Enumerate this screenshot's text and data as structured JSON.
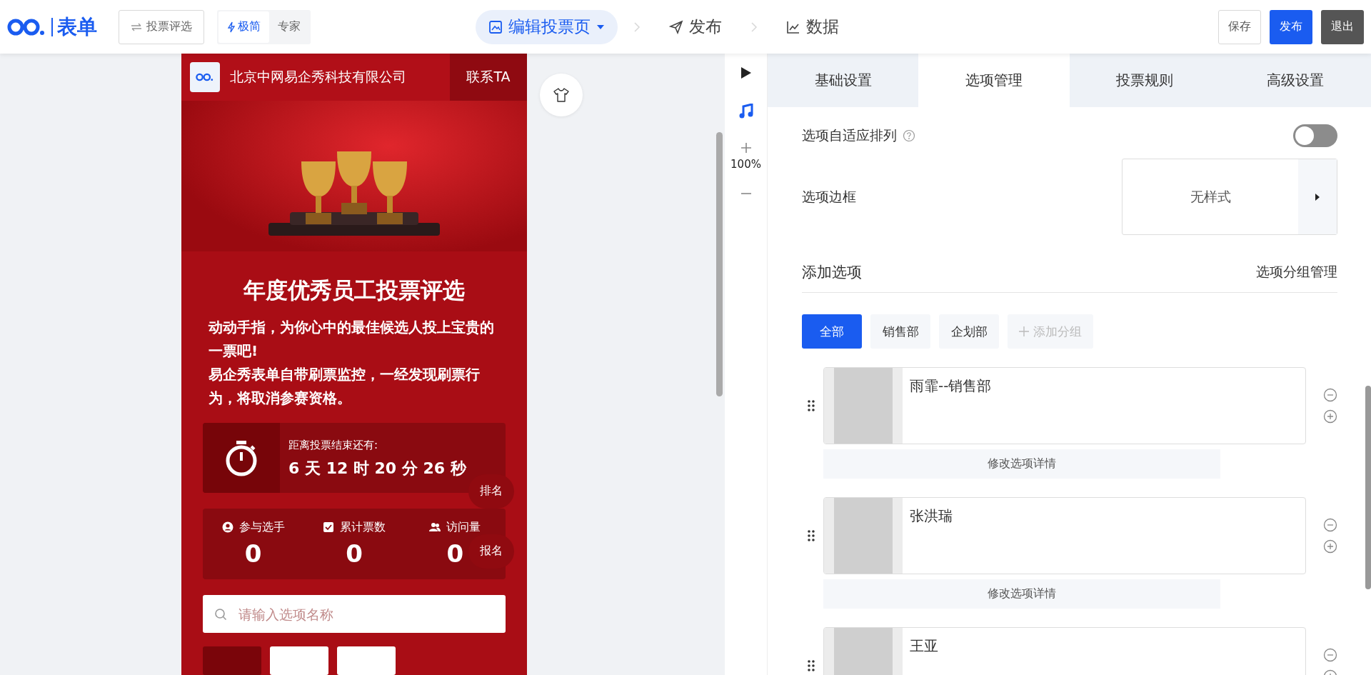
{
  "top_bar": {
    "logo_text": "表单",
    "back_button": "投票评选",
    "mode_tabs": [
      {
        "label": "极简",
        "selected": true
      },
      {
        "label": "专家",
        "selected": false
      }
    ],
    "steps": [
      {
        "label": "编辑投票页",
        "kind": "edit",
        "selected": true
      },
      {
        "label": "发布",
        "kind": "publish",
        "selected": false
      },
      {
        "label": "数据",
        "kind": "data",
        "selected": false
      }
    ],
    "actions": [
      {
        "label": "保存",
        "kind": "outline"
      },
      {
        "label": "发布",
        "kind": "primary"
      },
      {
        "label": "退出",
        "kind": "dark"
      }
    ]
  },
  "preview": {
    "company": "北京中网易企秀科技有限公司",
    "contact": "联系TA",
    "title": "年度优秀员工投票评选",
    "paragraphs": [
      "动动手指，为你心中的最佳候选人投上宝贵的一票吧!",
      "易企秀表单自带刷票监控，一经发现刷票行为，将取消参赛资格。"
    ],
    "countdown": {
      "label": "距离投票结束还有:",
      "value": "6 天 12 时 20 分 26 秒"
    },
    "ranking_badge": "排名",
    "stats": [
      {
        "kind": "players",
        "label": "参与选手",
        "value": "0"
      },
      {
        "kind": "votes",
        "label": "累计票数",
        "value": "0"
      },
      {
        "kind": "visits",
        "label": "访问量",
        "value": "0"
      }
    ],
    "signup_badge": "报名",
    "search": {
      "placeholder": "请输入选项名称"
    },
    "group_chips": [
      {
        "selected": true
      },
      {
        "selected": false
      },
      {
        "selected": false
      }
    ]
  },
  "zoom": {
    "level_text": "100%"
  },
  "settings": {
    "tabs": [
      {
        "label": "基础设置",
        "selected": false
      },
      {
        "label": "选项管理",
        "selected": true
      },
      {
        "label": "投票规则",
        "selected": false
      },
      {
        "label": "高级设置",
        "selected": false
      }
    ],
    "adaptive": {
      "label": "选项自适应排列",
      "on": false
    },
    "border": {
      "label": "选项边框",
      "value": "无样式"
    },
    "add_section": {
      "title": "添加选项",
      "link": "选项分组管理"
    },
    "groups": [
      {
        "label": "全部",
        "selected": true
      },
      {
        "label": "销售部",
        "selected": false
      },
      {
        "label": "企划部",
        "selected": false
      }
    ],
    "add_group": "添加分组",
    "options": [
      {
        "name": "雨霏--销售部",
        "detail_button": "修改选项详情"
      },
      {
        "name": "张洪瑞",
        "detail_button": "修改选项详情"
      },
      {
        "name": "王亚"
      }
    ]
  }
}
